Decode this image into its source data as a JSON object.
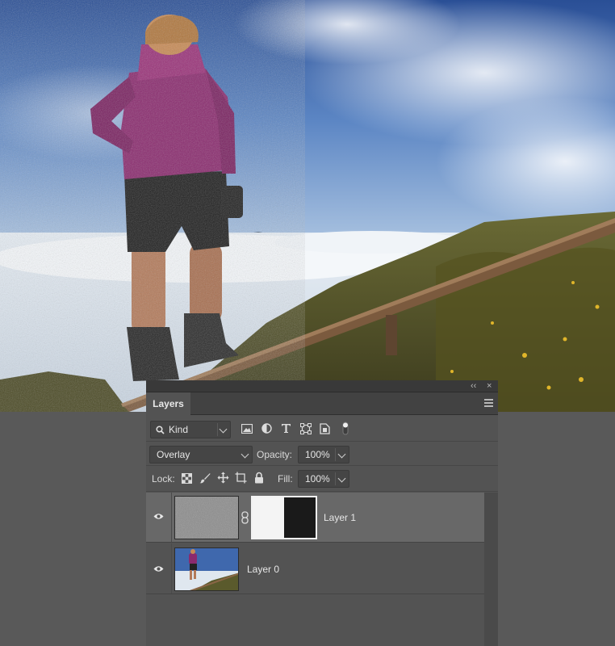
{
  "canvas": {
    "description_icon": "photo-canvas"
  },
  "panel": {
    "collapse_glyph": "‹‹",
    "close_glyph": "×",
    "tab_label": "Layers",
    "menu_icon": "hamburger-icon",
    "filter": {
      "kind_label": "Kind",
      "kind_icon": "search-icon",
      "filter_icons": [
        "image-filter-icon",
        "adjustment-filter-icon",
        "type-filter-icon",
        "shape-filter-icon",
        "smart-object-filter-icon",
        "filter-toggle-icon"
      ]
    },
    "blend": {
      "mode": "Overlay",
      "opacity_label": "Opacity:",
      "opacity_value": "100%"
    },
    "lock": {
      "label": "Lock:",
      "icons": [
        "lock-transparent-icon",
        "lock-pixels-icon",
        "lock-position-icon",
        "lock-artboard-icon",
        "lock-all-icon"
      ],
      "fill_label": "Fill:",
      "fill_value": "100%"
    },
    "layers": [
      {
        "name": "Layer 1",
        "selected": true,
        "has_mask": true
      },
      {
        "name": "Layer 0",
        "selected": false,
        "has_mask": false
      }
    ]
  },
  "colors": {
    "workspace": "#595959",
    "panel": "#535353",
    "selected_row": "#686868",
    "jacket": "#8a2a6e"
  }
}
